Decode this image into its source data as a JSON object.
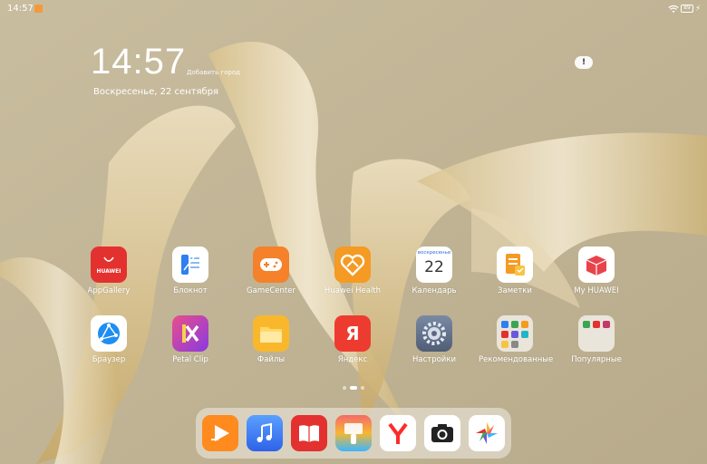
{
  "status": {
    "time": "14:57",
    "battery": "89",
    "icons": [
      "notification-badge-icon",
      "wifi-icon",
      "battery-icon",
      "charging-bolt-icon"
    ]
  },
  "widget": {
    "clock": "14:57",
    "add_city": "Добавить город",
    "date": "Воскресенье, 22 сентября"
  },
  "apps": [
    {
      "name": "AppGallery",
      "icon": "appgallery-icon",
      "tile_text": "HUAWEI"
    },
    {
      "name": "Блокнот",
      "icon": "notepad-icon"
    },
    {
      "name": "GameCenter",
      "icon": "gamecenter-icon"
    },
    {
      "name": "Huawei Health",
      "icon": "health-icon"
    },
    {
      "name": "Календарь",
      "icon": "calendar-icon",
      "tile_top": "воскресенье",
      "tile_day": "22"
    },
    {
      "name": "Заметки",
      "icon": "notes-icon"
    },
    {
      "name": "My HUAWEI",
      "icon": "my-huawei-icon"
    },
    {
      "name": "Браузер",
      "icon": "browser-icon"
    },
    {
      "name": "Petal Clip",
      "icon": "petal-clip-icon"
    },
    {
      "name": "Файлы",
      "icon": "files-icon"
    },
    {
      "name": "Яндекс",
      "icon": "yandex-icon",
      "tile_text": "Я"
    },
    {
      "name": "Настройки",
      "icon": "settings-gear-icon"
    },
    {
      "name": "Рекомендованные",
      "icon": "recommended-folder-icon"
    },
    {
      "name": "Популярные",
      "icon": "popular-folder-icon"
    }
  ],
  "dock": [
    {
      "icon": "video-play-icon"
    },
    {
      "icon": "music-note-icon"
    },
    {
      "icon": "books-icon"
    },
    {
      "icon": "themes-brush-icon"
    },
    {
      "icon": "yandex-browser-icon"
    },
    {
      "icon": "camera-icon"
    },
    {
      "icon": "gallery-petal-icon"
    }
  ],
  "colors": {
    "accent_red": "#e3312f",
    "accent_orange": "#f59a22",
    "wallpaper_base": "#c2b596"
  }
}
